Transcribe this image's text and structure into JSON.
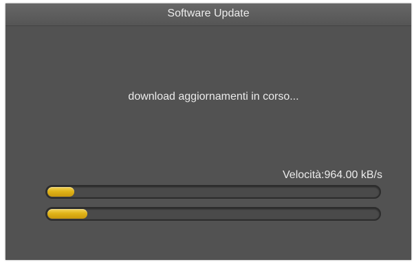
{
  "dialog": {
    "title": "Software Update",
    "status": "download aggiornamenti in corso...",
    "speed_label": "Velocità:",
    "speed_value": "964.00 kB/s"
  },
  "progress": {
    "current_file_fraction": 0.08,
    "overall_fraction": 0.12
  },
  "colors": {
    "dialog_background": "#525252",
    "text": "#ececec",
    "progress_fill": "#e0b418"
  }
}
